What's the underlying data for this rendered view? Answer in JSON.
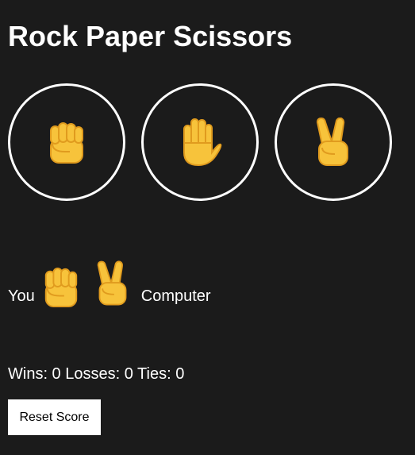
{
  "title": "Rock Paper Scissors",
  "choices": [
    {
      "name": "rock",
      "icon": "raised-fist-icon"
    },
    {
      "name": "paper",
      "icon": "raised-hand-icon"
    },
    {
      "name": "scissors",
      "icon": "victory-hand-icon"
    }
  ],
  "result": {
    "you_label": "You",
    "player_move": "rock",
    "computer_move": "scissors",
    "computer_label": "Computer"
  },
  "score": {
    "text": "Wins: 0 Losses: 0 Ties: 0",
    "wins": 0,
    "losses": 0,
    "ties": 0
  },
  "reset_label": "Reset Score",
  "colors": {
    "background": "#1b1b1b",
    "text": "#ffffff",
    "emoji_fill": "#f7c33b",
    "emoji_outline": "#e09b1e"
  }
}
